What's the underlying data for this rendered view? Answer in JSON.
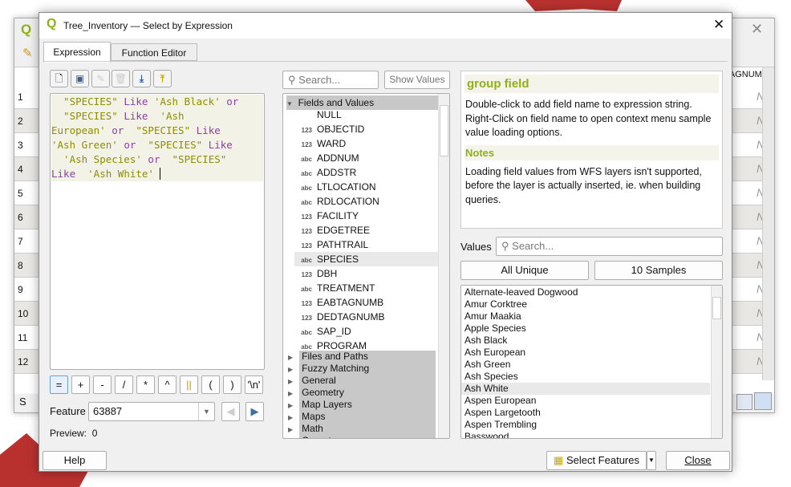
{
  "background_window": {
    "column_header": "TAGNUM",
    "row_numbers": [
      "1",
      "2",
      "3",
      "4",
      "5",
      "6",
      "7",
      "8",
      "9",
      "10",
      "11",
      "12"
    ],
    "cell_value": "N",
    "status_text": "S"
  },
  "dialog": {
    "title": "Tree_Inventory — Select by Expression",
    "tabs": [
      {
        "label": "Expression"
      },
      {
        "label": "Function Editor"
      }
    ],
    "expression": {
      "lines": [
        [
          {
            "t": "  \"SPECIES\" ",
            "c": "st"
          },
          {
            "t": "Like",
            "c": "kw"
          },
          {
            "t": " 'Ash Black' ",
            "c": "st"
          },
          {
            "t": "or",
            "c": "kw"
          }
        ],
        [
          {
            "t": "  \"SPECIES\" ",
            "c": "st"
          },
          {
            "t": "Like",
            "c": "kw"
          },
          {
            "t": "  'Ash",
            "c": "st"
          }
        ],
        [
          {
            "t": "European' ",
            "c": "st"
          },
          {
            "t": "or",
            "c": "kw"
          },
          {
            "t": "  \"SPECIES\" ",
            "c": "st"
          },
          {
            "t": "Like",
            "c": "kw"
          }
        ],
        [
          {
            "t": "'Ash Green' ",
            "c": "st"
          },
          {
            "t": "or",
            "c": "kw"
          },
          {
            "t": "  \"SPECIES\" ",
            "c": "st"
          },
          {
            "t": "Like",
            "c": "kw"
          }
        ],
        [
          {
            "t": "  'Ash Species' ",
            "c": "st"
          },
          {
            "t": "or",
            "c": "kw"
          },
          {
            "t": "  \"SPECIES\"",
            "c": "st"
          }
        ],
        [
          {
            "t": "Like",
            "c": "kw"
          },
          {
            "t": "  'Ash White' ",
            "c": "st"
          }
        ]
      ],
      "operators": [
        "=",
        "+",
        "-",
        "/",
        "*",
        "^",
        "||",
        "(",
        ")",
        "'\\n'"
      ],
      "feature_label": "Feature",
      "feature_value": "63887",
      "preview_label": "Preview:",
      "preview_value": "0"
    },
    "functions": {
      "search_placeholder": "Search...",
      "show_values_label": "Show Values",
      "group": "Fields and Values",
      "fields": [
        {
          "type": "",
          "name": "NULL"
        },
        {
          "type": "123",
          "name": "OBJECTID"
        },
        {
          "type": "123",
          "name": "WARD"
        },
        {
          "type": "abc",
          "name": "ADDNUM"
        },
        {
          "type": "abc",
          "name": "ADDSTR"
        },
        {
          "type": "abc",
          "name": "LTLOCATION"
        },
        {
          "type": "abc",
          "name": "RDLOCATION"
        },
        {
          "type": "123",
          "name": "FACILITY"
        },
        {
          "type": "123",
          "name": "EDGETREE"
        },
        {
          "type": "123",
          "name": "PATHTRAIL"
        },
        {
          "type": "abc",
          "name": "SPECIES"
        },
        {
          "type": "123",
          "name": "DBH"
        },
        {
          "type": "abc",
          "name": "TREATMENT"
        },
        {
          "type": "123",
          "name": "EABTAGNUMB"
        },
        {
          "type": "123",
          "name": "DEDTAGNUMB"
        },
        {
          "type": "abc",
          "name": "SAP_ID"
        },
        {
          "type": "abc",
          "name": "PROGRAM"
        }
      ],
      "selected_field": "SPECIES",
      "groups": [
        "Files and Paths",
        "Fuzzy Matching",
        "General",
        "Geometry",
        "Map Layers",
        "Maps",
        "Math",
        "Operators"
      ]
    },
    "help": {
      "title": "group field",
      "body": "Double-click to add field name to expression string. Right-Click on field name to open context menu sample value loading options.",
      "notes_title": "Notes",
      "notes_body": "Loading field values from WFS layers isn't supported, before the layer is actually inserted, ie. when building queries."
    },
    "values": {
      "label": "Values",
      "search_placeholder": "Search...",
      "all_unique_label": "All Unique",
      "samples_label": "10 Samples",
      "items": [
        "Alternate-leaved Dogwood",
        "Amur Corktree",
        "Amur Maakia",
        "Apple Species",
        "Ash Black",
        "Ash European",
        "Ash Green",
        "Ash Species",
        "Ash White",
        "Aspen European",
        "Aspen Largetooth",
        "Aspen Trembling",
        "Basswood"
      ],
      "selected": "Ash White"
    },
    "footer": {
      "help_label": "Help",
      "select_features_label": "Select Features",
      "close_label": "Close"
    },
    "colors": {
      "accent": "#8fb01a",
      "keyword": "#8b3fa8",
      "string": "#8e8e00",
      "map_fill": "#b8312f"
    }
  }
}
